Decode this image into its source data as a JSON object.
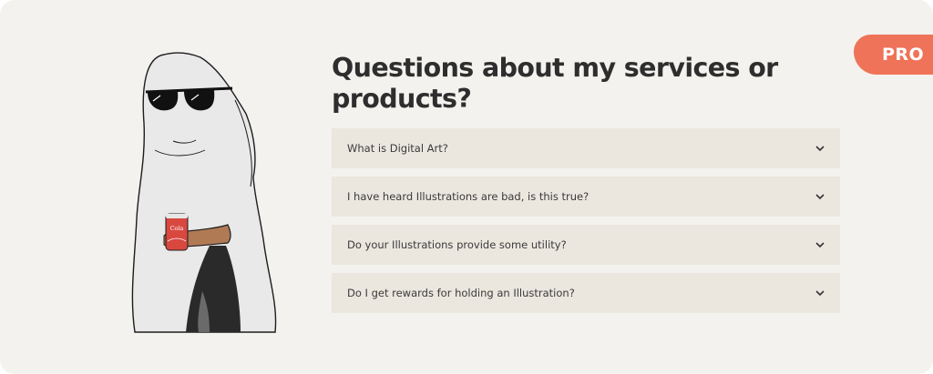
{
  "badge": {
    "label": "PRO"
  },
  "section": {
    "title": "Questions about my services or products?"
  },
  "faq": {
    "items": [
      {
        "question": "What is Digital Art?"
      },
      {
        "question": "I have heard Illustrations are bad, is this true?"
      },
      {
        "question": "Do your Illustrations provide some utility?"
      },
      {
        "question": "Do I get rewards for holding an Illustration?"
      }
    ]
  },
  "illustration": {
    "can_text": "Cola",
    "icon": "ghost-with-sunglasses-holding-soda-can"
  },
  "colors": {
    "background": "#f4f2ee",
    "badge": "#ef7358",
    "faq_item": "#ebe7df",
    "heading": "#2e2e2e"
  }
}
